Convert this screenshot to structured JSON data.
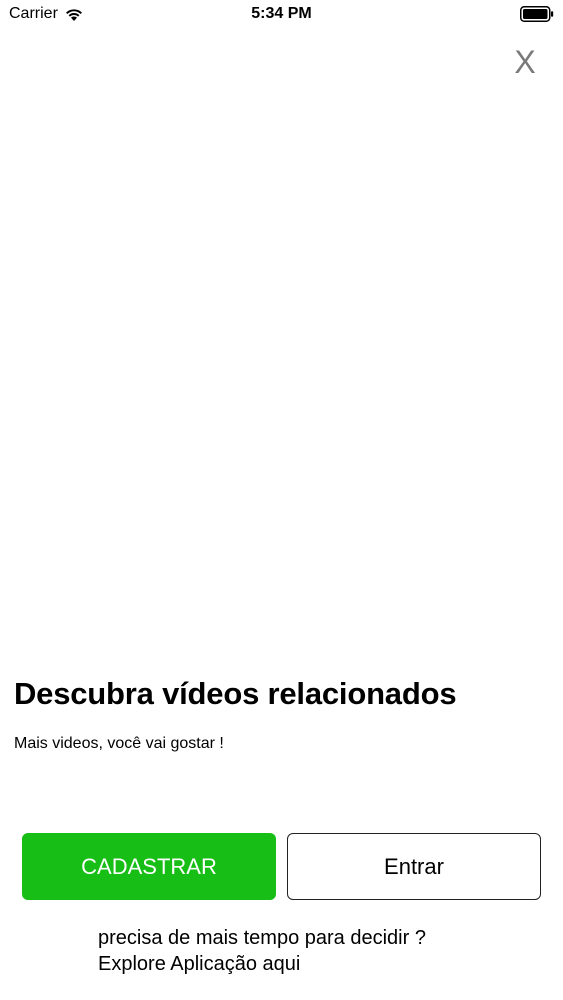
{
  "status_bar": {
    "carrier": "Carrier",
    "time": "5:34 PM"
  },
  "close": {
    "label": "X"
  },
  "content": {
    "title": "Descubra vídeos relacionados",
    "subtitle": "Mais videos, você vai gostar !"
  },
  "buttons": {
    "signup_label": "CADASTRAR",
    "login_label": "Entrar"
  },
  "explore": {
    "line1": "precisa de mais tempo para decidir ?",
    "line2": "Explore Aplicação aqui"
  },
  "colors": {
    "accent": "#16be16",
    "close_gray": "#7a7a7a"
  },
  "icons": [
    "wifi-icon",
    "battery-icon"
  ]
}
